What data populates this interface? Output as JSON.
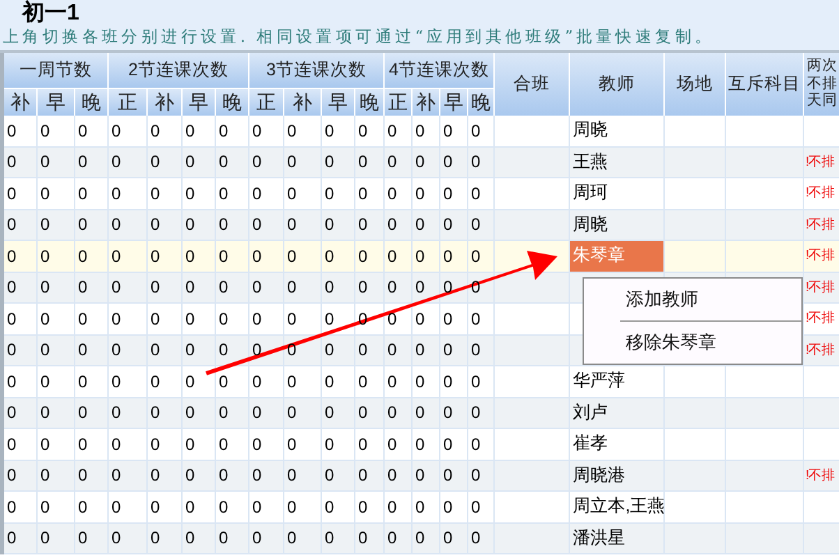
{
  "title": "初一1",
  "instruction": "上角切换各班分别进行设置. 相同设置项可通过“应用到其他班级”批量快速复制。",
  "table": {
    "groups": [
      {
        "label": "一周节数",
        "columns": [
          "补",
          "早",
          "晚"
        ]
      },
      {
        "label": "2节连课次数",
        "columns": [
          "正",
          "补",
          "早",
          "晚"
        ]
      },
      {
        "label": "3节连课次数",
        "columns": [
          "正",
          "补",
          "早",
          "晚"
        ]
      },
      {
        "label": "4节连课次数",
        "columns": [
          "正",
          "补",
          "早",
          "晚"
        ]
      }
    ],
    "columns": [
      "合班",
      "教师",
      "场地",
      "互斥科目"
    ],
    "last_column": [
      "两次",
      "不排",
      "天同"
    ],
    "rows": [
      {
        "counts": [
          "0",
          "0",
          "0",
          "0",
          "0",
          "0",
          "0",
          "0",
          "0",
          "0",
          "0",
          "0",
          "0",
          "0",
          "0"
        ],
        "teacher": "周晓",
        "selected": false
      },
      {
        "counts": [
          "0",
          "0",
          "0",
          "0",
          "0",
          "0",
          "0",
          "0",
          "0",
          "0",
          "0",
          "0",
          "0",
          "0",
          "0"
        ],
        "teacher": "王燕",
        "flag": "!不排",
        "selected": false
      },
      {
        "counts": [
          "0",
          "0",
          "0",
          "0",
          "0",
          "0",
          "0",
          "0",
          "0",
          "0",
          "0",
          "0",
          "0",
          "0",
          "0"
        ],
        "teacher": "周珂",
        "flag": "!不排",
        "selected": false
      },
      {
        "counts": [
          "0",
          "0",
          "0",
          "0",
          "0",
          "0",
          "0",
          "0",
          "0",
          "0",
          "0",
          "0",
          "0",
          "0",
          "0"
        ],
        "teacher": "周晓",
        "flag": "!不排",
        "selected": false
      },
      {
        "counts": [
          "0",
          "0",
          "0",
          "0",
          "0",
          "0",
          "0",
          "0",
          "0",
          "0",
          "0",
          "0",
          "0",
          "0",
          "0"
        ],
        "teacher": "朱琴章",
        "flag": "!不排",
        "selected": true
      },
      {
        "counts": [
          "0",
          "0",
          "0",
          "0",
          "0",
          "0",
          "0",
          "0",
          "0",
          "0",
          "0",
          "0",
          "0",
          "0",
          "0"
        ],
        "flag": "!不排",
        "selected": false
      },
      {
        "counts": [
          "0",
          "0",
          "0",
          "0",
          "0",
          "0",
          "0",
          "0",
          "0",
          "0",
          "0",
          "0",
          "0",
          "0",
          "0"
        ],
        "flag": "!不排",
        "selected": false
      },
      {
        "counts": [
          "0",
          "0",
          "0",
          "0",
          "0",
          "0",
          "0",
          "0",
          "0",
          "0",
          "0",
          "0",
          "0",
          "0",
          "0"
        ],
        "flag": "!不排",
        "selected": false
      },
      {
        "counts": [
          "0",
          "0",
          "0",
          "0",
          "0",
          "0",
          "0",
          "0",
          "0",
          "0",
          "0",
          "0",
          "0",
          "0",
          "0"
        ],
        "teacher": "华严萍",
        "selected": false
      },
      {
        "counts": [
          "0",
          "0",
          "0",
          "0",
          "0",
          "0",
          "0",
          "0",
          "0",
          "0",
          "0",
          "0",
          "0",
          "0",
          "0"
        ],
        "teacher": "刘卢",
        "selected": false
      },
      {
        "counts": [
          "0",
          "0",
          "0",
          "0",
          "0",
          "0",
          "0",
          "0",
          "0",
          "0",
          "0",
          "0",
          "0",
          "0",
          "0"
        ],
        "teacher": "崔孝",
        "selected": false
      },
      {
        "counts": [
          "0",
          "0",
          "0",
          "0",
          "0",
          "0",
          "0",
          "0",
          "0",
          "0",
          "0",
          "0",
          "0",
          "0",
          "0"
        ],
        "teacher": "周晓港",
        "flag": "!不排",
        "selected": false
      },
      {
        "counts": [
          "0",
          "0",
          "0",
          "0",
          "0",
          "0",
          "0",
          "0",
          "0",
          "0",
          "0",
          "0",
          "0",
          "0",
          "0"
        ],
        "teacher": "周立本,王燕",
        "selected": false
      },
      {
        "counts": [
          "0",
          "0",
          "0",
          "0",
          "0",
          "0",
          "0",
          "0",
          "0",
          "0",
          "0",
          "0",
          "0",
          "0",
          "0"
        ],
        "teacher": "潘洪星",
        "selected": false
      }
    ]
  },
  "context_menu": {
    "items": [
      "添加教师",
      "移除朱琴章"
    ]
  }
}
